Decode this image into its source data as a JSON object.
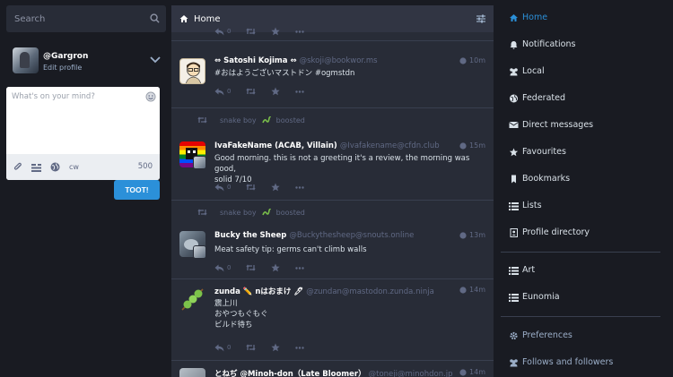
{
  "search": {
    "placeholder": "Search"
  },
  "account": {
    "username": "@Gargron",
    "edit": "Edit profile"
  },
  "compose": {
    "placeholder": "What's on your mind?",
    "cw": "cw",
    "count": "500",
    "toot": "TOOT!"
  },
  "header": {
    "title": "Home"
  },
  "statuses": [
    {
      "name": "⇔ Satoshi Kojima ⇔",
      "handle": "@skoji@bookwor.ms",
      "time": "10m",
      "text": [
        "#おはようございマストドン #ogmstdn"
      ],
      "reply": "0",
      "boosted_by": ""
    },
    {
      "name": "IvaFakeName (ACAB, Villain)",
      "handle": "@Ivafakename@cfdn.club",
      "time": "15m",
      "text": [
        "Good morning. this is not a greeting it's a review, the morning was good,",
        "solid 7/10"
      ],
      "reply": "0",
      "boosted_by": "snake boy",
      "boost_label": "boosted"
    },
    {
      "name": "Bucky the Sheep",
      "handle": "@Buckythesheep@snouts.online",
      "time": "13m",
      "text": [
        "Meat safety tip: germs can't climb walls"
      ],
      "reply": "0",
      "boosted_by": "snake boy",
      "boost_label": "boosted"
    },
    {
      "name": "zunda ✏️ nはおまけ 🖊",
      "handle": "@zundan@mastodon.zunda.ninja",
      "time": "14m",
      "text": [
        "震上川",
        "おやつもぐもぐ",
        "ビルド待ち"
      ],
      "reply": "0",
      "boosted_by": ""
    },
    {
      "name": "とねぢ @Minoh-don（Late Bloomer）",
      "handle": "@toneji@minohdon.jp",
      "time": "14m",
      "text": [],
      "reply": "",
      "boosted_by": ""
    }
  ],
  "top_actions": {
    "reply": "0"
  },
  "nav": [
    {
      "label": "Home",
      "icon": "home-icon"
    },
    {
      "label": "Notifications",
      "icon": "bell-icon"
    },
    {
      "label": "Local",
      "icon": "users-icon"
    },
    {
      "label": "Federated",
      "icon": "globe-icon"
    },
    {
      "label": "Direct messages",
      "icon": "envelope-icon"
    },
    {
      "label": "Favourites",
      "icon": "star-icon"
    },
    {
      "label": "Bookmarks",
      "icon": "bookmark-icon"
    },
    {
      "label": "Lists",
      "icon": "list-icon"
    },
    {
      "label": "Profile directory",
      "icon": "address-book-icon"
    }
  ],
  "lists": [
    {
      "label": "Art"
    },
    {
      "label": "Eunomia"
    }
  ],
  "footer_nav": [
    {
      "label": "Preferences",
      "icon": "gear-icon"
    },
    {
      "label": "Follows and followers",
      "icon": "users-icon"
    }
  ],
  "colors": {
    "accent": "#2b90d9",
    "bg": "#191b22",
    "column": "#282c37",
    "header": "#313543"
  }
}
